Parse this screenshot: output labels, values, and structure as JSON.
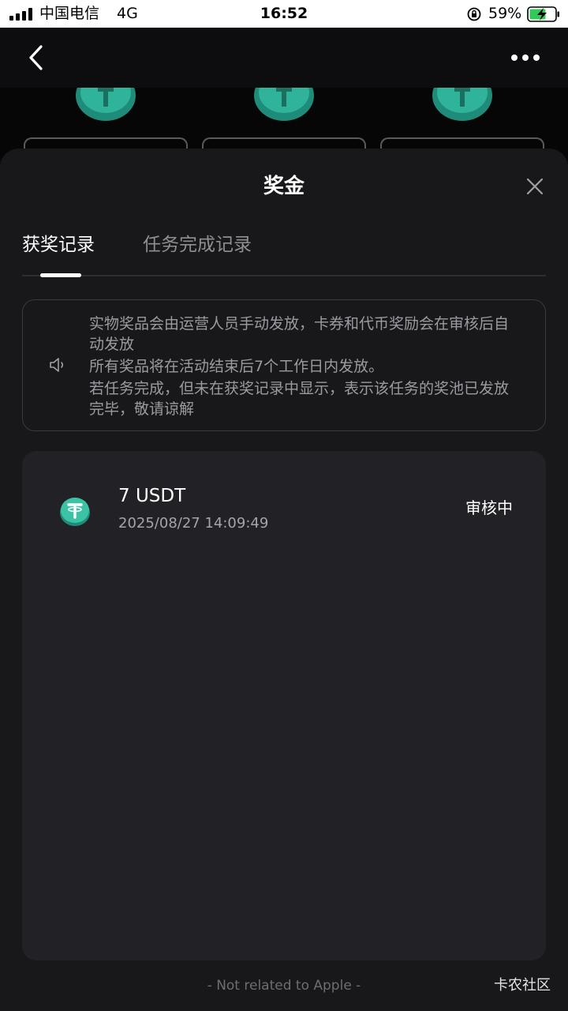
{
  "status_bar": {
    "carrier": "中国电信",
    "network": "4G",
    "time": "16:52",
    "battery_percent": "59%"
  },
  "nav": {
    "back_icon": "chevron-left-icon",
    "more_icon": "more-dots-icon"
  },
  "sheet": {
    "title": "奖金",
    "close_icon": "close-icon",
    "tabs": [
      {
        "label": "获奖记录",
        "active": true
      },
      {
        "label": "任务完成记录",
        "active": false
      }
    ],
    "notice": {
      "icon": "speaker-icon",
      "lines": [
        "实物奖品会由运营人员手动发放，卡券和代币奖励会在审核后自动发放",
        "所有奖品将在活动结束后7个工作日内发放。",
        "若任务完成，但未在获奖记录中显示，表示该任务的奖池已发放完毕，敬请谅解"
      ]
    },
    "records": [
      {
        "icon": "usdt-coin-icon",
        "amount": "7 USDT",
        "time": "2025/08/27 14:09:49",
        "status": "审核中"
      }
    ]
  },
  "footer": {
    "note": "- Not related to Apple -",
    "watermark": "卡农社区"
  },
  "colors": {
    "background": "#0b0b0c",
    "sheet": "#18181b",
    "card": "#222226",
    "coin": "#2fb39a",
    "muted_text": "#9a9aa0"
  }
}
